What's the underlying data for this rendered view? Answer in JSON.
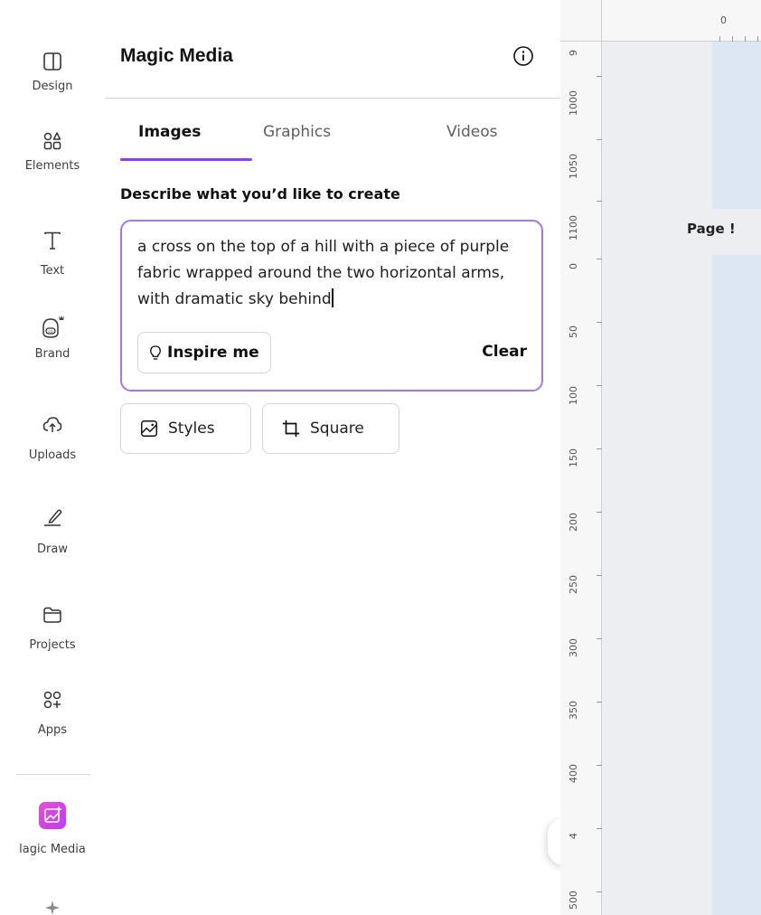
{
  "sidebar": {
    "items": [
      {
        "label": "Design",
        "icon": "layout-icon"
      },
      {
        "label": "Elements",
        "icon": "shapes-icon"
      },
      {
        "label": "Text",
        "icon": "text-icon"
      },
      {
        "label": "Brand",
        "icon": "brand-icon"
      },
      {
        "label": "Uploads",
        "icon": "cloud-upload-icon"
      },
      {
        "label": "Draw",
        "icon": "pen-icon"
      },
      {
        "label": "Projects",
        "icon": "folder-icon"
      },
      {
        "label": "Apps",
        "icon": "apps-icon"
      },
      {
        "label": "lagic Media",
        "icon": "magic-media-icon"
      }
    ]
  },
  "panel": {
    "title": "Magic Media",
    "tabs": [
      {
        "label": "Images",
        "active": true
      },
      {
        "label": "Graphics",
        "active": false
      },
      {
        "label": "Videos",
        "active": false
      }
    ],
    "prompt_label": "Describe what you’d like to create",
    "prompt_text": "a cross on the top of a hill with a piece of purple fabric wrapped around the two horizontal arms, with dramatic sky behind",
    "inspire_label": "Inspire me",
    "clear_label": "Clear",
    "styles_label": "Styles",
    "aspect_label": "Square"
  },
  "canvas": {
    "page_label": "Page !",
    "ruler_top": [
      "0"
    ],
    "ruler_left": [
      "9",
      "1000",
      "1050",
      "1100",
      "0",
      "50",
      "100",
      "150",
      "200",
      "250",
      "300",
      "350",
      "400",
      "4",
      "500"
    ]
  },
  "colors": {
    "accent": "#8b3dff",
    "prompt_border": "#a675f5",
    "magic_media": "#d94fe6",
    "page_fill": "#dde7f3"
  }
}
